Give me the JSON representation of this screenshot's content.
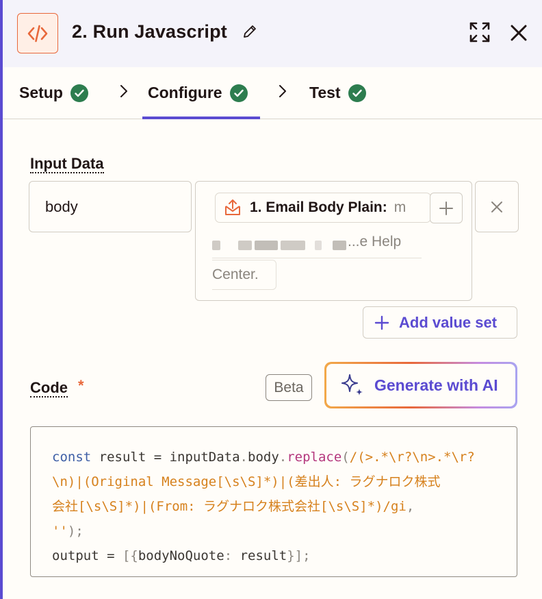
{
  "header": {
    "title": "2. Run Javascript",
    "app_icon": "code-brackets-icon",
    "colors": {
      "accent": "#5b4bd1",
      "brand": "#e8683b",
      "success": "#2d7d4f"
    }
  },
  "tabs": [
    {
      "label": "Setup",
      "status": "complete"
    },
    {
      "label": "Configure",
      "status": "complete",
      "active": true
    },
    {
      "label": "Test",
      "status": "complete"
    }
  ],
  "input_data": {
    "label": "Input Data",
    "key": "body",
    "value_pill": {
      "label": "1. Email Body Plain:",
      "rest": "m"
    },
    "line2_text": "...e  Help",
    "line3_text": "Center.",
    "add_value_label": "Add value set"
  },
  "code": {
    "label": "Code",
    "required_mark": "*",
    "beta_label": "Beta",
    "generate_label": "Generate with AI",
    "lines": [
      [
        {
          "t": "const",
          "c": "kw"
        },
        {
          "t": " result = inputData",
          "c": ""
        },
        {
          "t": ".",
          "c": "pn"
        },
        {
          "t": "body",
          "c": ""
        },
        {
          "t": ".",
          "c": "pn"
        },
        {
          "t": "replace",
          "c": "fn"
        },
        {
          "t": "(",
          "c": "pn"
        },
        {
          "t": "/(>.*\\r?\\n>.*\\r?",
          "c": "rx"
        }
      ],
      [
        {
          "t": "\\n)|(Original Message[\\s\\S]*)|(差出人: ラグナロク株式",
          "c": "rx"
        }
      ],
      [
        {
          "t": "会社[\\s\\S]*)|(From: ラグナロク株式会社[\\s\\S]*)/gi",
          "c": "rx"
        },
        {
          "t": ",",
          "c": "pn"
        }
      ],
      [
        {
          "t": "''",
          "c": "rx"
        },
        {
          "t": ");",
          "c": "pn"
        }
      ],
      [
        {
          "t": "output = ",
          "c": ""
        },
        {
          "t": "[{",
          "c": "pn"
        },
        {
          "t": "bodyNoQuote",
          "c": ""
        },
        {
          "t": ":",
          "c": "pn"
        },
        {
          "t": " result",
          "c": ""
        },
        {
          "t": "}];",
          "c": "pn"
        }
      ]
    ]
  }
}
